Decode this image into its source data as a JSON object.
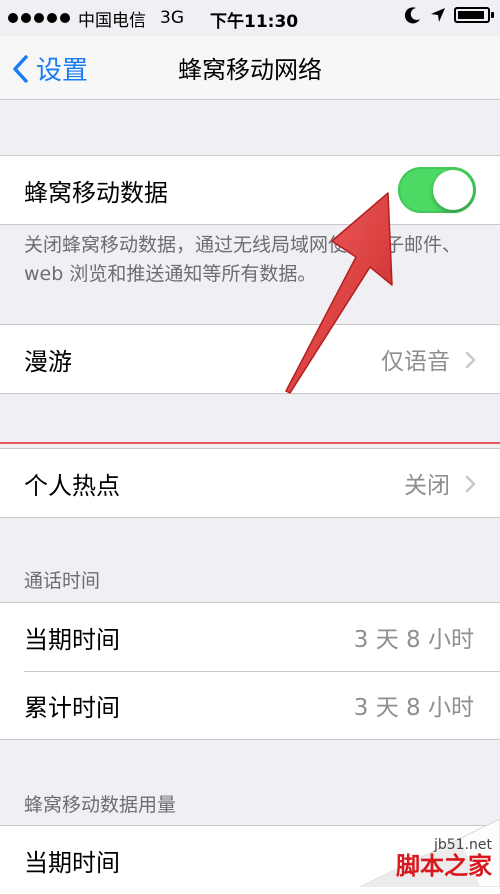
{
  "statusbar": {
    "carrier": "中国电信",
    "network": "3G",
    "time": "下午11:30"
  },
  "navbar": {
    "back_label": "设置",
    "title": "蜂窝移动网络"
  },
  "cellular_data": {
    "label": "蜂窝移动数据",
    "enabled": true,
    "footer": "关闭蜂窝移动数据，通过无线局域网使用电子邮件、web 浏览和推送通知等所有数据。"
  },
  "roaming": {
    "label": "漫游",
    "value": "仅语音"
  },
  "hotspot": {
    "label": "个人热点",
    "value": "关闭"
  },
  "call_time": {
    "header": "通话时间",
    "rows": [
      {
        "label": "当期时间",
        "value": "3 天 8 小时"
      },
      {
        "label": "累计时间",
        "value": "3 天 8 小时"
      }
    ]
  },
  "data_usage": {
    "header": "蜂窝移动数据用量",
    "rows": [
      {
        "label": "当期时间"
      }
    ]
  },
  "watermark": {
    "site": "jb51.net",
    "name": "脚本之家"
  },
  "colors": {
    "accent": "#1a7cf5",
    "toggle_on": "#4cd964",
    "annotation_arrow": "#e53c3c"
  }
}
